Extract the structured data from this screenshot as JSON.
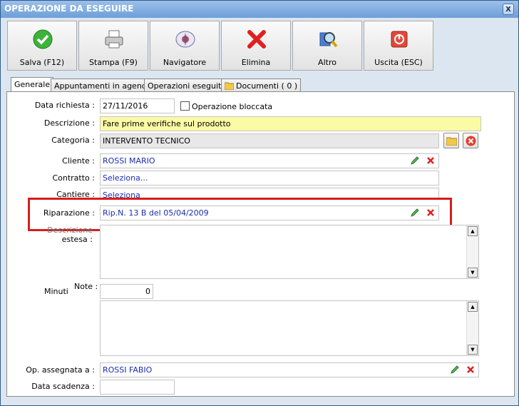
{
  "window": {
    "title": "OPERAZIONE DA ESEGUIRE",
    "close_label": "x"
  },
  "toolbar": {
    "buttons": [
      {
        "label": "Salva (F12)",
        "icon": "check-icon"
      },
      {
        "label": "Stampa (F9)",
        "icon": "printer-icon"
      },
      {
        "label": "Navigatore",
        "icon": "compass-icon"
      },
      {
        "label": "Elimina",
        "icon": "delete-x-icon"
      },
      {
        "label": "Altro",
        "icon": "search-glass-icon"
      },
      {
        "label": "Uscita (ESC)",
        "icon": "exit-icon"
      }
    ]
  },
  "tabs": [
    "Generale",
    "Appuntamenti in agenda",
    "Operazioni eseguite",
    "Documenti ( 0 )"
  ],
  "form": {
    "data_richiesta_label": "Data richiesta :",
    "data_richiesta_value": "27/11/2016",
    "operazione_bloccata_label": "Operazione bloccata",
    "descrizione_label": "Descrizione :",
    "descrizione_value": "Fare prime verifiche sul prodotto",
    "categoria_label": "Categoria :",
    "categoria_value": "INTERVENTO TECNICO",
    "cliente_label": "Cliente :",
    "cliente_value": "ROSSI MARIO",
    "contratto_label": "Contratto :",
    "contratto_value": "Seleziona...",
    "cantiere_label": "Cantiere :",
    "cantiere_value": "Seleziona",
    "riparazione_label": "Riparazione :",
    "riparazione_value": "Rip.N. 13 B del 05/04/2009",
    "descrizione_estesa_label_1": "Descrizione",
    "descrizione_estesa_label_2": "estesa :",
    "minuti_label": "Minuti",
    "note_label": "Note :",
    "minuti_value": "0",
    "op_assegnata_label": "Op. assegnata a :",
    "op_assegnata_value": "ROSSI FABIO",
    "data_scadenza_label": "Data scadenza :",
    "data_scadenza_value": ""
  },
  "colors": {
    "highlight": "#d81d1d",
    "link_text": "#1a2db0",
    "yellow_field": "#fbfba6",
    "title_bar": "#7fa9dd"
  }
}
